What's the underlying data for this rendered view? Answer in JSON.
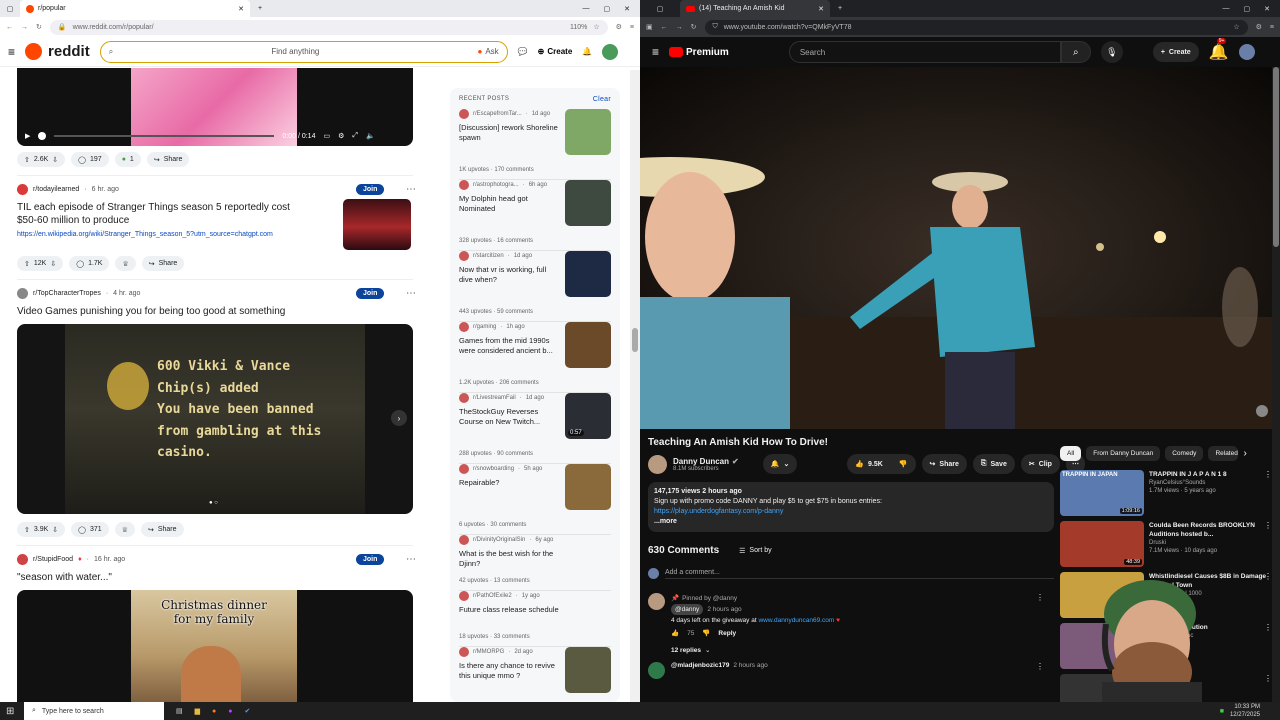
{
  "left_browser": {
    "tab_title": "r/popular",
    "url": "www.reddit.com/r/popular/",
    "zoom": "110%"
  },
  "reddit": {
    "logo": "reddit",
    "search_placeholder": "Find anything",
    "ask_label": "Ask",
    "create_label": "Create",
    "video_time": "0:00 / 0:14",
    "post0_actions": {
      "votes": "2.6K",
      "comments": "197",
      "awards": "1",
      "share": "Share"
    },
    "posts": [
      {
        "sub": "r/todayilearned",
        "age": "6 hr. ago",
        "join": "Join",
        "title": "TIL each episode of Stranger Things season 5 reportedly cost $50-60 million to produce",
        "link": "https://en.wikipedia.org/wiki/Stranger_Things_season_5?utm_source=chatgpt.com",
        "votes": "12K",
        "comments": "1.7K",
        "share": "Share"
      },
      {
        "sub": "r/TopCharacterTropes",
        "age": "4 hr. ago",
        "join": "Join",
        "title": "Video Games punishing you for being too good at something",
        "image_lines": [
          "600 Vikki & Vance",
          "Chip(s) added",
          "You have been banned",
          "from gambling at this",
          "casino."
        ],
        "votes": "3.9K",
        "comments": "371",
        "share": "Share"
      },
      {
        "sub": "r/StupidFood",
        "age": "16 hr. ago",
        "join": "Join",
        "title": "\"season with water...\"",
        "image_caption_1": "Christmas dinner",
        "image_caption_2": "for my family"
      }
    ],
    "recent": {
      "heading": "RECENT POSTS",
      "clear": "Clear",
      "items": [
        {
          "sub": "r/EscapefromTar...",
          "age": "1d ago",
          "title": "[Discussion] rework Shoreline spawn",
          "meta": "1K upvotes · 170 comments",
          "color": "#7fa866"
        },
        {
          "sub": "r/astrophotogra...",
          "age": "6h ago",
          "title": "My Dolphin head got Nominated",
          "meta": "328 upvotes · 16 comments",
          "color": "#3e4a40"
        },
        {
          "sub": "r/starcitizen",
          "age": "1d ago",
          "title": "Now that vr is working, full dive when?",
          "meta": "443 upvotes · 59 comments",
          "color": "#1e2a44"
        },
        {
          "sub": "r/gaming",
          "age": "1h ago",
          "title": "Games from the mid 1990s were considered ancient b...",
          "meta": "1.2K upvotes · 206 comments",
          "color": "#6b4a2a"
        },
        {
          "sub": "r/LivestreamFail",
          "age": "1d ago",
          "title": "TheStockGuy Reverses Course on New Twitch...",
          "meta": "288 upvotes · 90 comments",
          "color": "#2a2d33",
          "badge": "0:57"
        },
        {
          "sub": "r/snowboarding",
          "age": "5h ago",
          "title": "Repairable?",
          "meta": "6 upvotes · 30 comments",
          "color": "#8a6a3a"
        },
        {
          "sub": "r/DivinityOriginalSin",
          "age": "6y ago",
          "title": "What is the best wish for the Djinn?",
          "meta": "42 upvotes · 13 comments"
        },
        {
          "sub": "r/PathOfExile2",
          "age": "1y ago",
          "title": "Future class release schedule",
          "meta": "18 upvotes · 33 comments"
        },
        {
          "sub": "r/MMORPG",
          "age": "2d ago",
          "title": "Is there any chance to revive this unique mmo ?",
          "meta": "",
          "color": "#5a5a40"
        }
      ]
    }
  },
  "right_browser": {
    "tab_title": "(14) Teaching An Amish Kid",
    "url": "www.youtube.com/watch?v=QMkFyVT78"
  },
  "youtube": {
    "logo": "Premium",
    "search_placeholder": "Search",
    "create_label": "Create",
    "notif_count": "9+",
    "video_title": "Teaching An Amish Kid How To Drive!",
    "channel": "Danny Duncan",
    "subscribers": "8.1M subscribers",
    "likes": "9.5K",
    "share": "Share",
    "save": "Save",
    "clip": "Clip",
    "desc_stats": "147,175 views  2 hours ago",
    "desc_line": "Sign up with promo code DANNY and play $5 to get $75 in bonus entries:",
    "desc_link": "https://play.underdogfantasy.com/p-danny",
    "desc_more": "...more",
    "comment_count": "630 Comments",
    "sort_by": "Sort by",
    "add_comment": "Add a comment...",
    "pinned": "Pinned by @danny",
    "comment_author": "@danny",
    "comment_age": "2 hours ago",
    "comment_text": "4 days left on the giveaway at",
    "comment_link": "www.dannyduncan69.com",
    "comment_likes": "75",
    "reply": "Reply",
    "replies": "12 replies",
    "comment2_author": "@mladjenbozic179",
    "comment2_age": "2 hours ago",
    "chips": [
      "All",
      "From Danny Duncan",
      "Comedy",
      "Related"
    ],
    "recs": [
      {
        "title": "TRAPPIN IN  J A P A N 1 8",
        "channel": "RyanCelsius°Sounds",
        "meta": "1.7M views · 5 years ago",
        "thumb": "TRAPPIN IN JAPAN",
        "dur": "1:09:16",
        "color": "#5a7ab0"
      },
      {
        "title": "Coulda Been Records BROOKLYN Auditions hosted b...",
        "channel": "Druski",
        "meta": "7.1M views · 10 days ago",
        "dur": "48:39",
        "color": "#a33a2a"
      },
      {
        "title": "Whistlindiesel Causes $8B in Damage to Local Town",
        "channel": "WhistlinDiesel 1000",
        "meta": "6 hours ago",
        "color": "#c9a040"
      },
      {
        "title": "Tough - Rebelution",
        "channel": "RebelutionMusic",
        "meta": "· 13 years ago",
        "color": "#7b5a7a"
      },
      {
        "title": "...ke Zeb",
        "channel": "",
        "meta": "",
        "color": "#333"
      }
    ]
  },
  "taskbar": {
    "search_placeholder": "Type here to search",
    "time": "10:33 PM",
    "date": "12/27/2025"
  }
}
